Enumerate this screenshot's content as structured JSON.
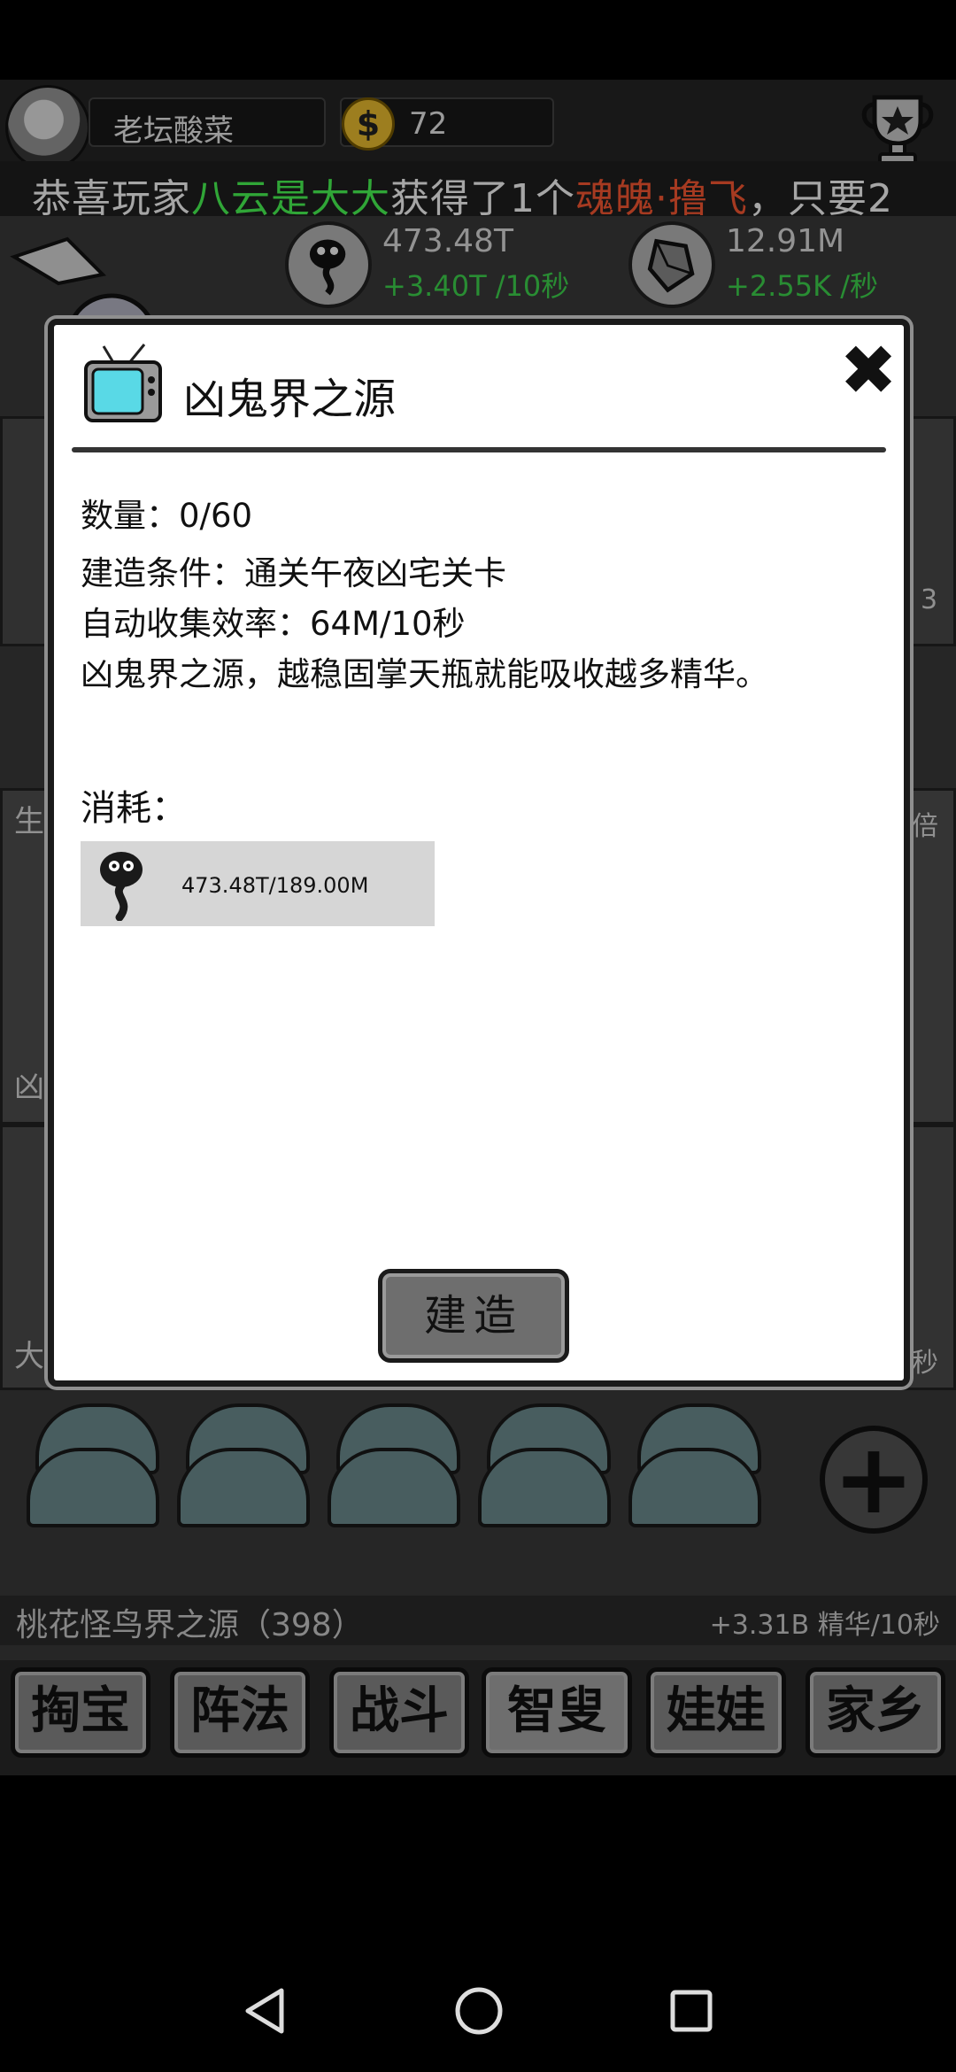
{
  "header": {
    "player_name": "老坛酸菜",
    "coin_symbol": "$",
    "coins": "72"
  },
  "marquee": {
    "prefix": "恭喜玩家",
    "player": "八云是大大",
    "middle": "获得了1个",
    "item": "魂魄·撸飞",
    "suffix": "，只要2"
  },
  "resources": [
    {
      "icon": "spirit-icon",
      "value": "473.48T",
      "rate": "+3.40T /10秒"
    },
    {
      "icon": "crystal-icon",
      "value": "12.91M",
      "rate": "+2.55K /秒"
    }
  ],
  "background_labels": {
    "left_a": "生",
    "left_b": "凶",
    "left_c": "大",
    "right_a": "倍",
    "right_b": "3",
    "right_c": "秒"
  },
  "source_line": {
    "name": "桃花怪鸟界之源（398）",
    "rate": "+3.31B 精华/10秒"
  },
  "nav": {
    "items": [
      "掏宝",
      "阵法",
      "战斗",
      "智叟",
      "娃娃",
      "家乡"
    ],
    "active_index": 3
  },
  "dialog": {
    "title": "凶鬼界之源",
    "close_symbol": "✖",
    "quantity": "数量：0/60",
    "condition": "建造条件：通关午夜凶宅关卡",
    "efficiency": "自动收集效率：64M/10秒",
    "description": "凶鬼界之源，越稳固掌天瓶就能吸收越多精华。",
    "cost_label": "消耗：",
    "cost_value": "473.48T/189.00M",
    "build_label": "建造"
  },
  "colors": {
    "accent_green": "#4bff55",
    "accent_red": "#ff5a33",
    "rate_green": "#3fd94f"
  }
}
